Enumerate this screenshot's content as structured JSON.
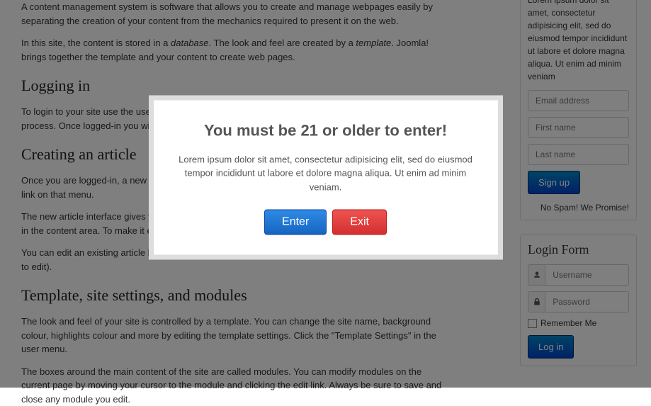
{
  "main": {
    "p_intro": "A content management system is software that allows you to create and manage webpages easily by separating the creation of your content from the mechanics required to present it on the web.",
    "p_db1": "In this site, the content is stored in a ",
    "em_db": "database",
    "p_db2": ". The look and feel are created by a ",
    "em_tpl": "template",
    "p_db3": ". Joomla! brings together the template and your content to create web pages.",
    "h_login": "Logging in",
    "p_login": "To login to your site use the user name and password that were created as part of the installation process. Once logged-in you will be able to create and edit articles and modify some settings.",
    "h_create": "Creating an article",
    "p_create1": "Once you are logged-in, a new menu will be visible. To create a new article, click on the \"Submit Article\" link on that menu.",
    "p_create2": "The new article interface gives you a lot of options, but all you need to do is add a title and put something in the content area. To make it easy to find, set the state to published.",
    "p_create3": "You can edit an existing article by clicking on the edit icon (this only displays to users who have the right to edit).",
    "h_tpl": "Template, site settings, and modules",
    "p_tpl1": "The look and feel of your site is controlled by a template. You can change the site name, background colour, highlights colour and more by editing the template settings. Click the \"Template Settings\" in the user menu.",
    "p_tpl2": "The boxes around the main content of the site are called modules. You can modify modules on the current page by moving your cursor to the module and clicking the edit link. Always be sure to save and close any module you edit."
  },
  "signup": {
    "desc": "Lorem ipsum dolor sit amet, consectetur adipisicing elit, sed do eiusmod tempor incididunt ut labore et dolore magna aliqua. Ut enim ad minim veniam",
    "email_ph": "Email address",
    "fn_ph": "First name",
    "ln_ph": "Last name",
    "btn": "Sign up",
    "note": "No Spam! We Promise!"
  },
  "login": {
    "title": "Login Form",
    "user_ph": "Username",
    "pass_ph": "Password",
    "remember": "Remember Me",
    "btn": "Log in"
  },
  "modal": {
    "title": "You must be 21 or older to enter!",
    "body": "Lorem ipsum dolor sit amet, consectetur adipisicing elit, sed do eiusmod tempor incididunt ut labore et dolore magna aliqua. Ut enim ad minim veniam.",
    "enter": "Enter",
    "exit": "Exit"
  }
}
